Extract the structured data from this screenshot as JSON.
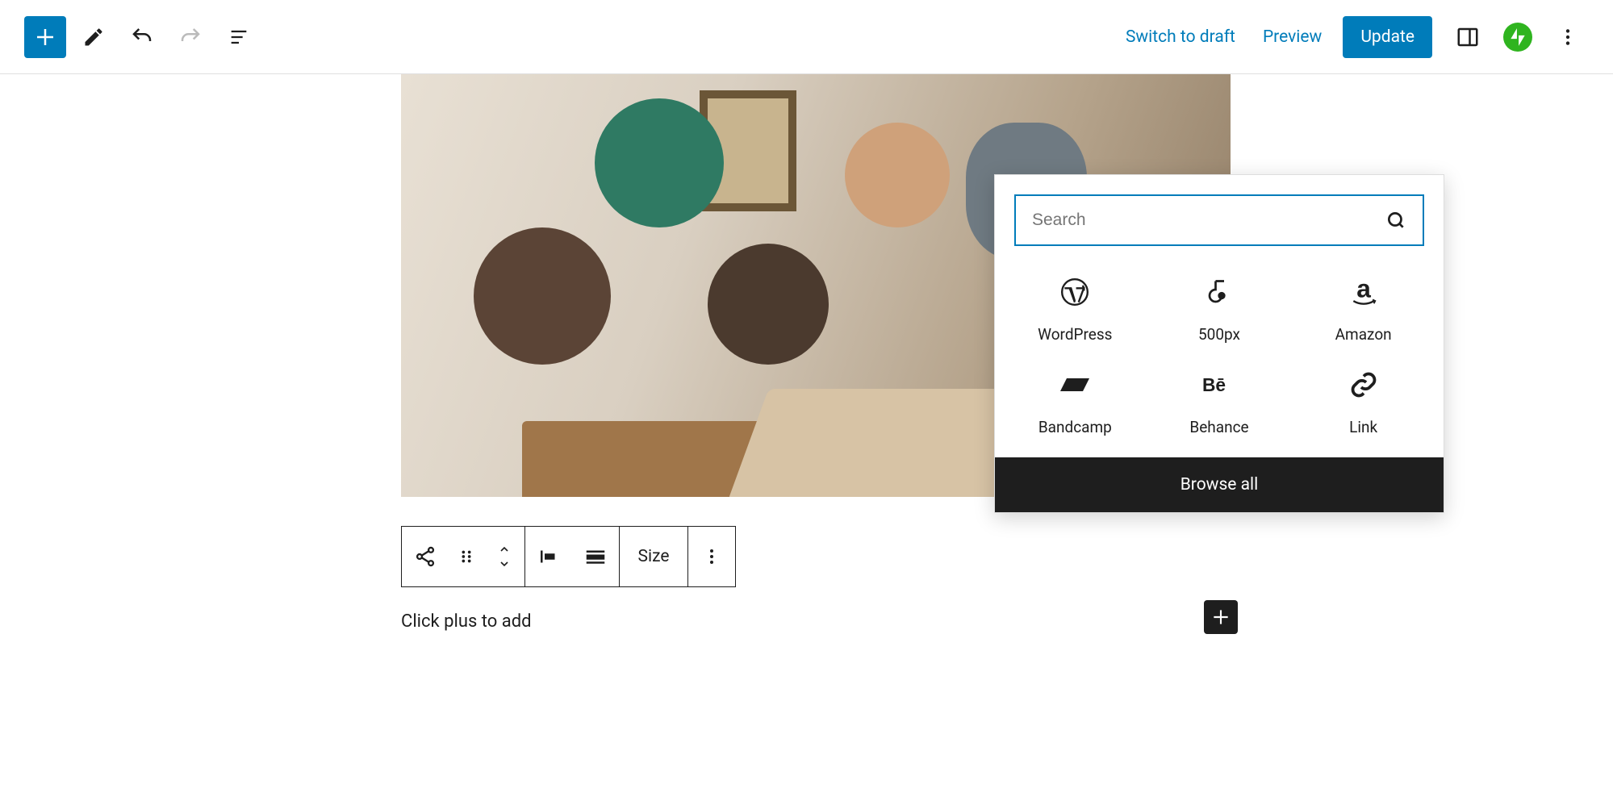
{
  "header": {
    "switch_to_draft": "Switch to draft",
    "preview": "Preview",
    "update": "Update"
  },
  "block_toolbar": {
    "size_label": "Size"
  },
  "paragraph_placeholder": "Click plus to add",
  "inserter": {
    "search_placeholder": "Search",
    "blocks": [
      {
        "label": "WordPress",
        "icon": "wordpress"
      },
      {
        "label": "500px",
        "icon": "fivehundredpx"
      },
      {
        "label": "Amazon",
        "icon": "amazon"
      },
      {
        "label": "Bandcamp",
        "icon": "bandcamp"
      },
      {
        "label": "Behance",
        "icon": "behance"
      },
      {
        "label": "Link",
        "icon": "link"
      }
    ],
    "browse_all": "Browse all"
  }
}
